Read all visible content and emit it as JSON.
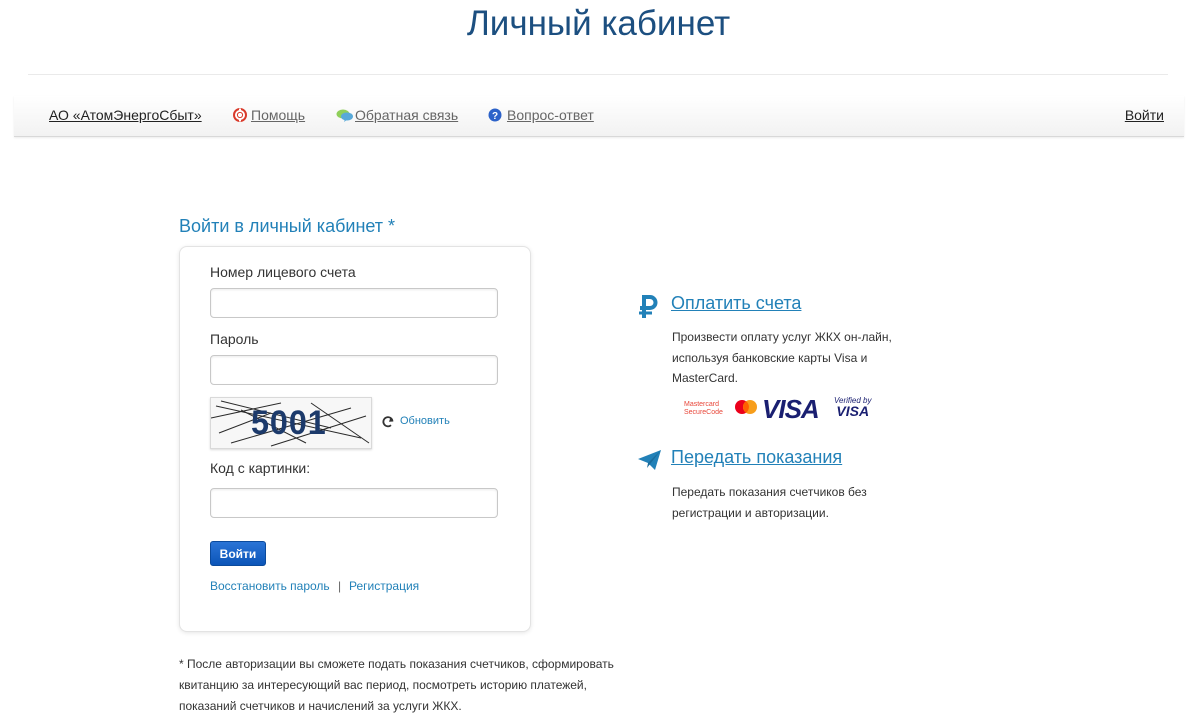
{
  "page": {
    "title": "Личный кабинет"
  },
  "nav": {
    "company": "АО «АтомЭнергоСбыт»",
    "help": "Помощь",
    "feedback": "Обратная связь",
    "faq": "Вопрос-ответ",
    "login": "Войти",
    "icons": {
      "help": "lifebuoy-icon",
      "feedback": "chat-bubbles-icon",
      "faq": "question-circle-icon"
    }
  },
  "login_form": {
    "heading": "Войти в личный кабинет *",
    "account_label": "Номер лицевого счета",
    "account_value": "",
    "password_label": "Пароль",
    "password_value": "",
    "captcha_code": "5001",
    "refresh_label": "Обновить",
    "captcha_label": "Код с картинки:",
    "captcha_value": "",
    "submit_label": "Войти",
    "restore_label": "Восстановить пароль",
    "separator": "|",
    "register_label": "Регистрация"
  },
  "footnote": "* После авторизации вы сможете подать показания счетчиков, сформировать квитанцию за интересующий вас период, посмотреть историю платежей, показаний счетчиков и начислений за услуги ЖКХ.",
  "services": {
    "pay": {
      "title": "Оплатить счета",
      "description": "Произвести оплату услуг ЖКХ он-лайн, используя банковские карты Visa и MasterCard.",
      "icon": "ruble-icon",
      "logos": {
        "mastercard_line1": "Mastercard",
        "mastercard_line2": "SecureCode",
        "visa": "VISA",
        "verified_line1": "Verified by",
        "verified_line2": "VISA"
      }
    },
    "readings": {
      "title": "Передать показания",
      "description": "Передать показания счетчиков без регистрации и авторизации.",
      "icon": "paper-plane-icon"
    }
  },
  "colors": {
    "title": "#1c4f80",
    "accent": "#2281b8",
    "button": "#0c55b8"
  }
}
